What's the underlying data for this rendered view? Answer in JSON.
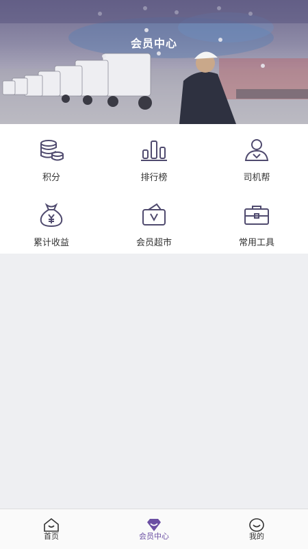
{
  "header": {
    "title": "会员中心"
  },
  "colors": {
    "accent": "#6b4fa3",
    "icon_stroke": "#4f4a6e"
  },
  "grid": {
    "items": [
      {
        "label": "积分",
        "icon": "coins-stack-icon"
      },
      {
        "label": "排行榜",
        "icon": "bar-chart-icon"
      },
      {
        "label": "司机帮",
        "icon": "person-icon"
      },
      {
        "label": "累计收益",
        "icon": "money-bag-icon"
      },
      {
        "label": "会员超市",
        "icon": "shopping-basket-icon"
      },
      {
        "label": "常用工具",
        "icon": "toolbox-icon"
      }
    ]
  },
  "tabbar": {
    "items": [
      {
        "label": "首页",
        "icon": "home-icon",
        "active": false
      },
      {
        "label": "会员中心",
        "icon": "diamond-icon",
        "active": true
      },
      {
        "label": "我的",
        "icon": "smile-icon",
        "active": false
      }
    ]
  }
}
